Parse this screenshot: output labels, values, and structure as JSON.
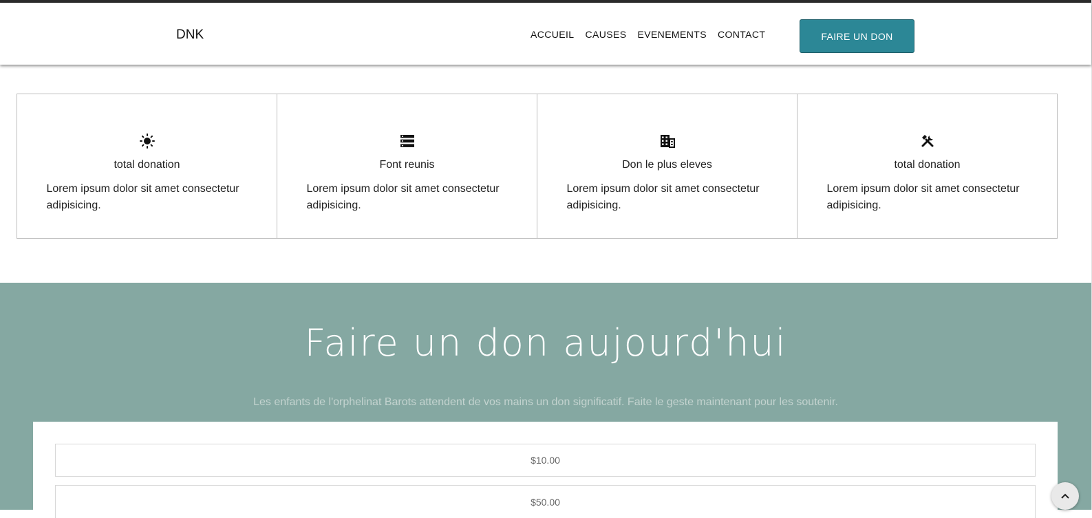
{
  "header": {
    "brand": "DNK",
    "nav": [
      "ACCUEIL",
      "CAUSES",
      "EVENEMENTS",
      "CONTACT"
    ],
    "cta_label": "FAIRE UN DON"
  },
  "features": [
    {
      "icon": "sun-icon",
      "title": "total donation",
      "text": "Lorem ipsum dolor sit amet consectetur adipisicing."
    },
    {
      "icon": "server-icon",
      "title": "Font reunis",
      "text": "Lorem ipsum dolor sit amet consectetur adipisicing."
    },
    {
      "icon": "building-icon",
      "title": "Don le plus eleves",
      "text": "Lorem ipsum dolor sit amet consectetur adipisicing."
    },
    {
      "icon": "tools-icon",
      "title": "total donation",
      "text": "Lorem ipsum dolor sit amet consectetur adipisicing."
    }
  ],
  "donate": {
    "title": "Faire un don aujourd'hui",
    "subtitle": "Les enfants de l'orphelinat Barots attendent de vos mains un don significatif. Faite le geste maintenant pour les soutenir.",
    "amounts": [
      "$10.00",
      "$50.00"
    ]
  },
  "colors": {
    "accent": "#2c8796",
    "section_bg": "#85a8a2"
  }
}
